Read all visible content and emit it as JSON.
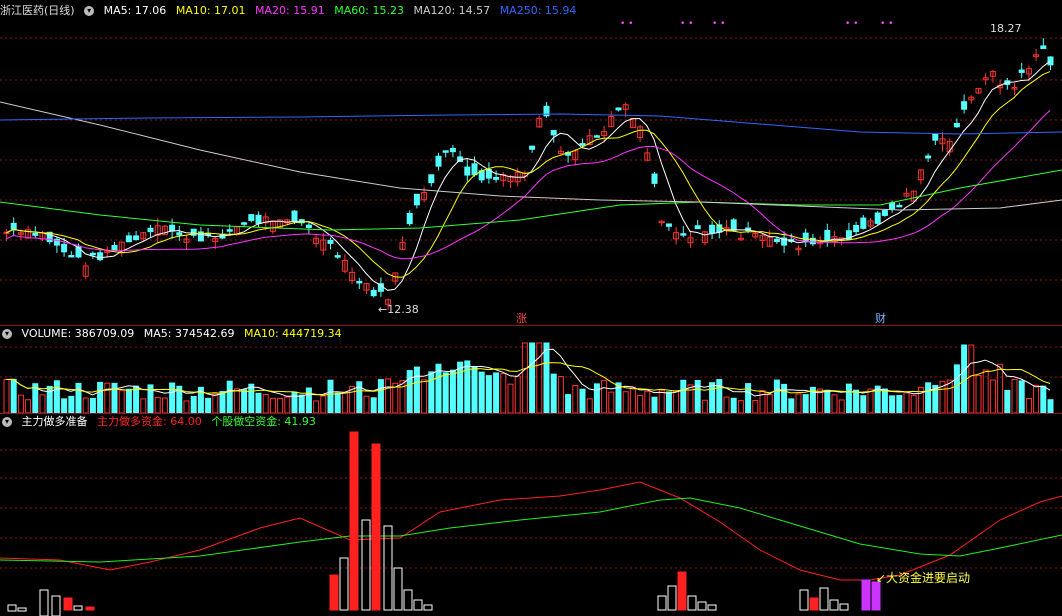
{
  "main": {
    "title": "浙江医药(日线)",
    "legend": [
      {
        "label": "MA5: 17.06",
        "color": "#ffffff"
      },
      {
        "label": "MA10: 17.01",
        "color": "#ffff00"
      },
      {
        "label": "MA20: 15.91",
        "color": "#ff33ff"
      },
      {
        "label": "MA60: 15.23",
        "color": "#33ff33"
      },
      {
        "label": "MA120: 14.57",
        "color": "#cccccc"
      },
      {
        "label": "MA250: 15.94",
        "color": "#3366ff"
      }
    ],
    "high_label": "18.27",
    "low_label": "12.38",
    "marker_zhang": "涨",
    "marker_cai": "财"
  },
  "volume": {
    "legend": [
      {
        "label": "VOLUME: 386709.09",
        "color": "#ffffff"
      },
      {
        "label": "MA5: 374542.69",
        "color": "#ffffff"
      },
      {
        "label": "MA10: 444719.34",
        "color": "#ffff00"
      }
    ]
  },
  "indicator": {
    "title": "主力做多准备",
    "legend": [
      {
        "label": "主力做多资金: 64.00",
        "color": "#ff2222"
      },
      {
        "label": "个股做空资金: 41.93",
        "color": "#33ff33"
      }
    ],
    "annotation": "大资金进要启动"
  },
  "colors": {
    "up": "#ff3333",
    "down": "#54ffff",
    "grid": "#8a1a1a"
  }
}
